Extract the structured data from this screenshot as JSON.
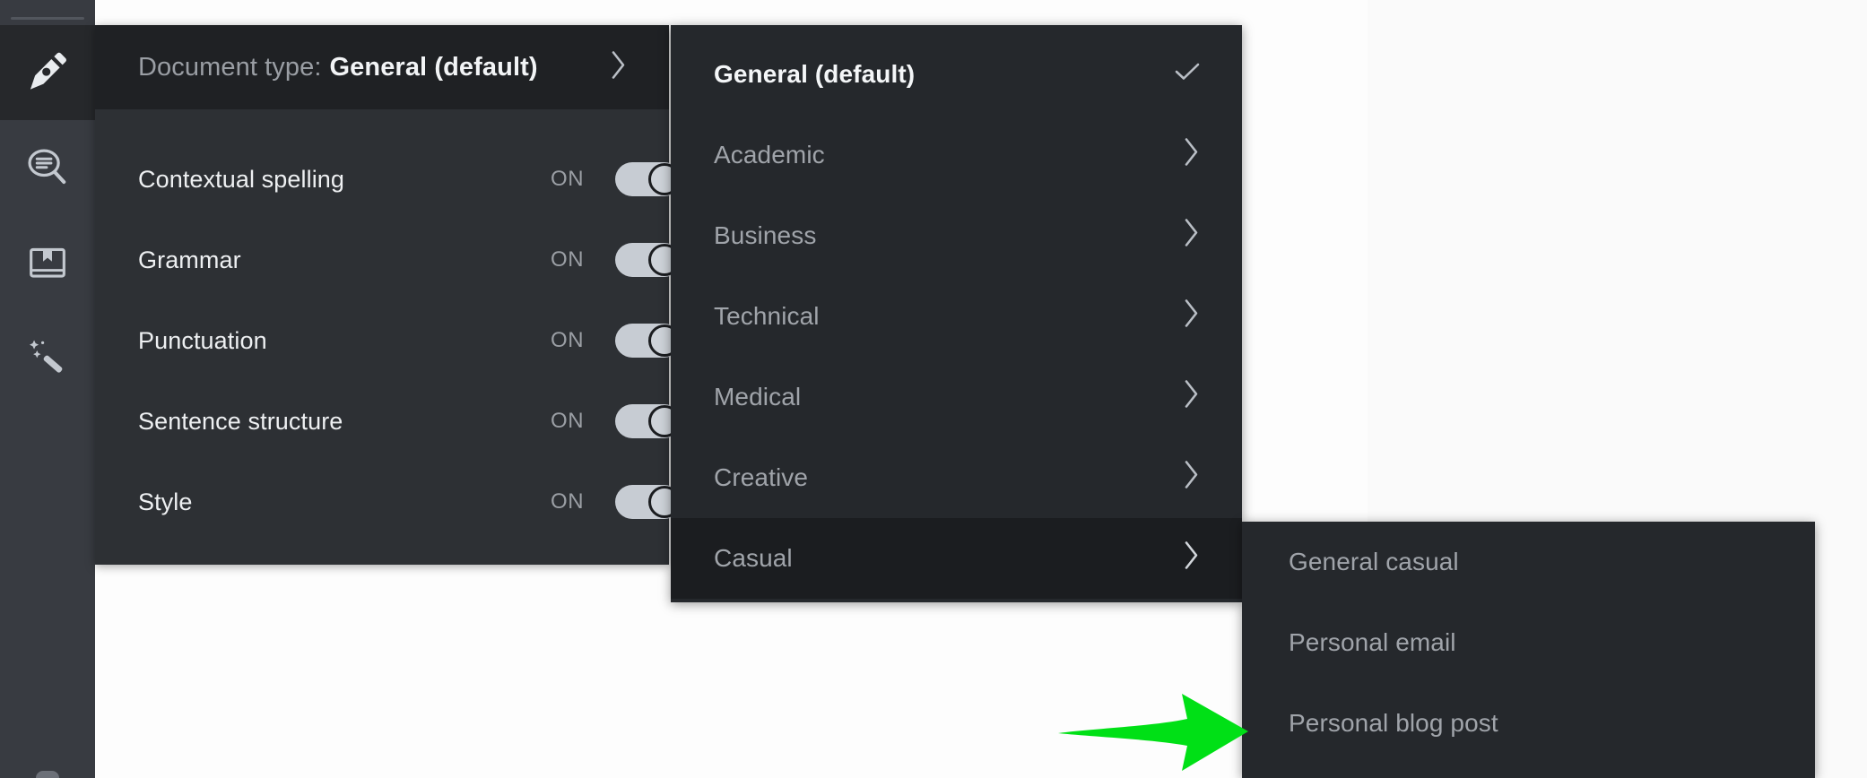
{
  "app": {
    "name": "grammar-assistant",
    "background_color": "#fdfdfd",
    "panel_color": "#2d3034",
    "menu_color": "#25282c",
    "accent_color": "#00e016"
  },
  "sidebar": {
    "items": [
      {
        "icon": "pen-nib-icon",
        "label": "Write",
        "active": true
      },
      {
        "icon": "document-search-icon",
        "label": "Review",
        "active": false
      },
      {
        "icon": "book-bookmark-icon",
        "label": "Dictionary",
        "active": false
      },
      {
        "icon": "magic-wand-icon",
        "label": "Enhance",
        "active": false
      }
    ]
  },
  "settings_panel": {
    "header": {
      "label": "Document type:",
      "value": "General (default)",
      "chevron": "chevron-right-icon"
    },
    "toggles": [
      {
        "label": "Contextual spelling",
        "state": "ON",
        "on": true
      },
      {
        "label": "Grammar",
        "state": "ON",
        "on": true
      },
      {
        "label": "Punctuation",
        "state": "ON",
        "on": true
      },
      {
        "label": "Sentence structure",
        "state": "ON",
        "on": true
      },
      {
        "label": "Style",
        "state": "ON",
        "on": true
      }
    ]
  },
  "document_type_menu": {
    "items": [
      {
        "label": "General (default)",
        "selected": true,
        "icon": "check-icon",
        "highlight": false
      },
      {
        "label": "Academic",
        "selected": false,
        "icon": "chevron-right-icon",
        "highlight": false
      },
      {
        "label": "Business",
        "selected": false,
        "icon": "chevron-right-icon",
        "highlight": false
      },
      {
        "label": "Technical",
        "selected": false,
        "icon": "chevron-right-icon",
        "highlight": false
      },
      {
        "label": "Medical",
        "selected": false,
        "icon": "chevron-right-icon",
        "highlight": false
      },
      {
        "label": "Creative",
        "selected": false,
        "icon": "chevron-right-icon",
        "highlight": false
      },
      {
        "label": "Casual",
        "selected": false,
        "icon": "chevron-right-icon",
        "highlight": true
      }
    ]
  },
  "casual_submenu": {
    "items": [
      {
        "label": "General casual"
      },
      {
        "label": "Personal email"
      },
      {
        "label": "Personal blog post"
      }
    ]
  },
  "annotation": {
    "arrow": {
      "name": "green-pointer-arrow",
      "color": "#00e016",
      "direction": "right"
    }
  }
}
